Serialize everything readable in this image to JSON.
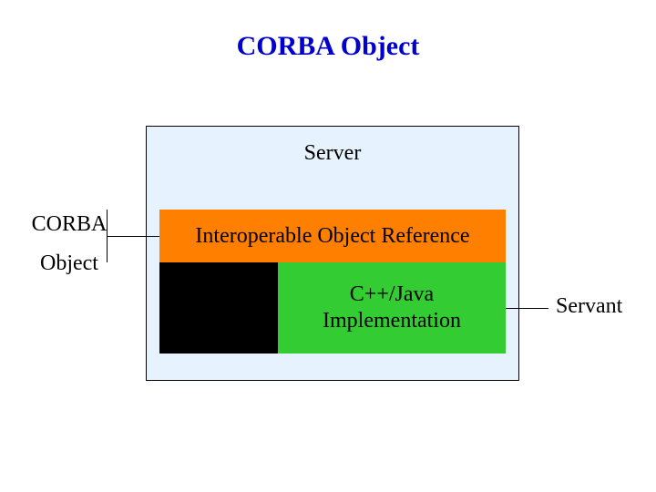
{
  "title": "CORBA Object",
  "server_label": "Server",
  "ior_label": "Interoperable Object Reference",
  "impl_label": "C++/Java\nImplementation",
  "corba_object_label": "CORBA\nObject",
  "servant_label": "Servant",
  "colors": {
    "title": "#0000cc",
    "server_bg": "#e6f3ff",
    "ior_bg": "#ff7f00",
    "impl_bg": "#33cc33",
    "black_box": "#000000"
  }
}
